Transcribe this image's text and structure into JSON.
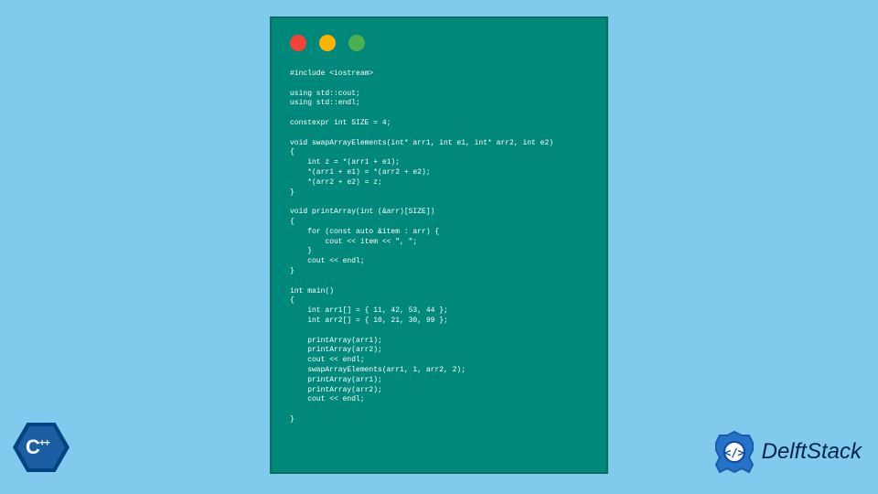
{
  "window": {
    "controls": [
      "red",
      "yellow",
      "green"
    ]
  },
  "code": "#include <iostream>\n\nusing std::cout;\nusing std::endl;\n\nconstexpr int SIZE = 4;\n\nvoid swapArrayElements(int* arr1, int e1, int* arr2, int e2)\n{\n    int z = *(arr1 + e1);\n    *(arr1 + e1) = *(arr2 + e2);\n    *(arr2 + e2) = z;\n}\n\nvoid printArray(int (&arr)[SIZE])\n{\n    for (const auto &item : arr) {\n        cout << item << \", \";\n    }\n    cout << endl;\n}\n\nint main()\n{\n    int arr1[] = { 11, 42, 53, 44 };\n    int arr2[] = { 10, 21, 30, 99 };\n\n    printArray(arr1);\n    printArray(arr2);\n    cout << endl;\n    swapArrayElements(arr1, 1, arr2, 2);\n    printArray(arr1);\n    printArray(arr2);\n    cout << endl;\n\n}",
  "cpp_badge": {
    "label": "C",
    "plus": "++"
  },
  "delft": {
    "text": "DelftStack"
  }
}
